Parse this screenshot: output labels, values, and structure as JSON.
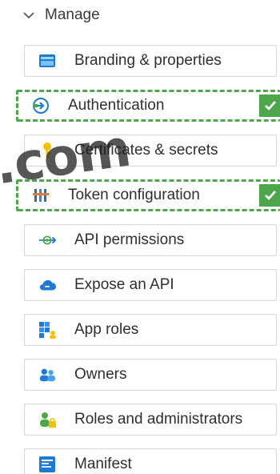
{
  "section": {
    "label": "Manage",
    "icon": "chevron-down-icon"
  },
  "items": [
    {
      "label": "Branding & properties",
      "icon": "branding-icon",
      "selected": false
    },
    {
      "label": "Authentication",
      "icon": "authentication-icon",
      "selected": true
    },
    {
      "label": "Certificates & secrets",
      "icon": "key-icon",
      "selected": false
    },
    {
      "label": "Token configuration",
      "icon": "token-icon",
      "selected": true
    },
    {
      "label": "API permissions",
      "icon": "api-permissions-icon",
      "selected": false
    },
    {
      "label": "Expose an API",
      "icon": "cloud-icon",
      "selected": false
    },
    {
      "label": "App roles",
      "icon": "app-roles-icon",
      "selected": false
    },
    {
      "label": "Owners",
      "icon": "owners-icon",
      "selected": false
    },
    {
      "label": "Roles and administrators",
      "icon": "roles-admin-icon",
      "selected": false
    },
    {
      "label": "Manifest",
      "icon": "manifest-icon",
      "selected": false
    }
  ],
  "watermark": ".com",
  "colors": {
    "selection": "#4ea64a",
    "brand_blue": "#1f7ad3",
    "key_yellow": "#f2c200"
  }
}
